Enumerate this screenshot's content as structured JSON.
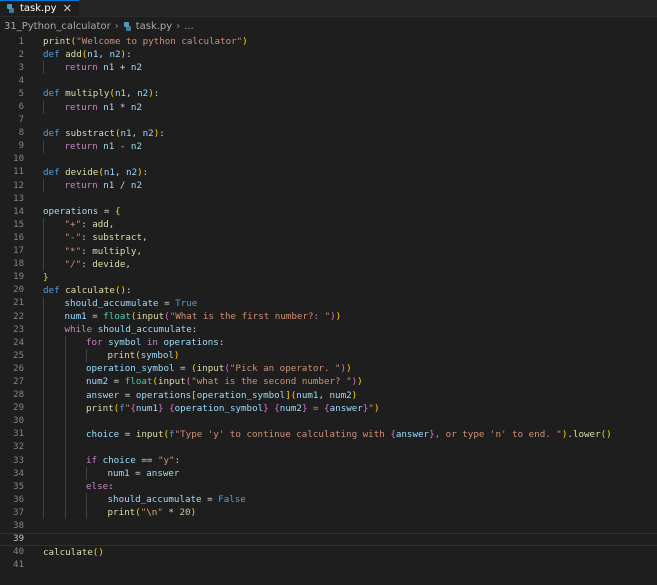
{
  "tab": {
    "title": "task.py",
    "close_glyph": "✕",
    "icon": "python-file-icon"
  },
  "breadcrumb": {
    "folder": "31_Python_calculator",
    "file": "task.py",
    "sep": "›",
    "trail": "..."
  },
  "editor": {
    "current_line": 39,
    "lines": [
      {
        "n": 1,
        "ind": 0,
        "tokens": [
          [
            "fn",
            "print"
          ],
          [
            "br1",
            "("
          ],
          [
            "str",
            "\"Welcome to python calculator\""
          ],
          [
            "br1",
            ")"
          ]
        ]
      },
      {
        "n": 2,
        "ind": 0,
        "tokens": [
          [
            "kw",
            "def "
          ],
          [
            "fn",
            "add"
          ],
          [
            "br1",
            "("
          ],
          [
            "var",
            "n1"
          ],
          [
            "op",
            ", "
          ],
          [
            "var",
            "n2"
          ],
          [
            "br1",
            ")"
          ],
          [
            "op",
            ":"
          ]
        ]
      },
      {
        "n": 3,
        "ind": 1,
        "tokens": [
          [
            "ctl",
            "return "
          ],
          [
            "var",
            "n1"
          ],
          [
            "op",
            " + "
          ],
          [
            "var",
            "n2"
          ]
        ]
      },
      {
        "n": 4,
        "ind": 0,
        "tokens": []
      },
      {
        "n": 5,
        "ind": 0,
        "tokens": [
          [
            "kw",
            "def "
          ],
          [
            "fn",
            "multiply"
          ],
          [
            "br1",
            "("
          ],
          [
            "var",
            "n1"
          ],
          [
            "op",
            ", "
          ],
          [
            "var",
            "n2"
          ],
          [
            "br1",
            ")"
          ],
          [
            "op",
            ":"
          ]
        ]
      },
      {
        "n": 6,
        "ind": 1,
        "tokens": [
          [
            "ctl",
            "return "
          ],
          [
            "var",
            "n1"
          ],
          [
            "op",
            " * "
          ],
          [
            "var",
            "n2"
          ]
        ]
      },
      {
        "n": 7,
        "ind": 0,
        "tokens": []
      },
      {
        "n": 8,
        "ind": 0,
        "tokens": [
          [
            "kw",
            "def "
          ],
          [
            "fn",
            "substract"
          ],
          [
            "br1",
            "("
          ],
          [
            "var",
            "n1"
          ],
          [
            "op",
            ", "
          ],
          [
            "var",
            "n2"
          ],
          [
            "br1",
            ")"
          ],
          [
            "op",
            ":"
          ]
        ]
      },
      {
        "n": 9,
        "ind": 1,
        "tokens": [
          [
            "ctl",
            "return "
          ],
          [
            "var",
            "n1"
          ],
          [
            "op",
            " - "
          ],
          [
            "var",
            "n2"
          ]
        ]
      },
      {
        "n": 10,
        "ind": 0,
        "tokens": []
      },
      {
        "n": 11,
        "ind": 0,
        "tokens": [
          [
            "kw",
            "def "
          ],
          [
            "fn",
            "devide"
          ],
          [
            "br1",
            "("
          ],
          [
            "var",
            "n1"
          ],
          [
            "op",
            ", "
          ],
          [
            "var",
            "n2"
          ],
          [
            "br1",
            ")"
          ],
          [
            "op",
            ":"
          ]
        ]
      },
      {
        "n": 12,
        "ind": 1,
        "tokens": [
          [
            "ctl",
            "return "
          ],
          [
            "var",
            "n1"
          ],
          [
            "op",
            " / "
          ],
          [
            "var",
            "n2"
          ]
        ]
      },
      {
        "n": 13,
        "ind": 0,
        "tokens": []
      },
      {
        "n": 14,
        "ind": 0,
        "tokens": [
          [
            "var",
            "operations"
          ],
          [
            "op",
            " = "
          ],
          [
            "br1",
            "{"
          ]
        ]
      },
      {
        "n": 15,
        "ind": 1,
        "tokens": [
          [
            "str",
            "\"+\""
          ],
          [
            "op",
            ": "
          ],
          [
            "fn",
            "add"
          ],
          [
            "op",
            ","
          ]
        ]
      },
      {
        "n": 16,
        "ind": 1,
        "tokens": [
          [
            "str",
            "\"-\""
          ],
          [
            "op",
            ": "
          ],
          [
            "fn",
            "substract"
          ],
          [
            "op",
            ","
          ]
        ]
      },
      {
        "n": 17,
        "ind": 1,
        "tokens": [
          [
            "str",
            "\"*\""
          ],
          [
            "op",
            ": "
          ],
          [
            "fn",
            "multiply"
          ],
          [
            "op",
            ","
          ]
        ]
      },
      {
        "n": 18,
        "ind": 1,
        "tokens": [
          [
            "str",
            "\"/\""
          ],
          [
            "op",
            ": "
          ],
          [
            "fn",
            "devide"
          ],
          [
            "op",
            ","
          ]
        ]
      },
      {
        "n": 19,
        "ind": 0,
        "tokens": [
          [
            "br1",
            "}"
          ]
        ]
      },
      {
        "n": 20,
        "ind": 0,
        "tokens": [
          [
            "kw",
            "def "
          ],
          [
            "fn",
            "calculate"
          ],
          [
            "br1",
            "()"
          ],
          [
            "op",
            ":"
          ]
        ]
      },
      {
        "n": 21,
        "ind": 1,
        "tokens": [
          [
            "var",
            "should_accumulate"
          ],
          [
            "op",
            " = "
          ],
          [
            "kw",
            "True"
          ]
        ]
      },
      {
        "n": 22,
        "ind": 1,
        "tokens": [
          [
            "var",
            "num1"
          ],
          [
            "op",
            " = "
          ],
          [
            "cls",
            "float"
          ],
          [
            "br1",
            "("
          ],
          [
            "fn",
            "input"
          ],
          [
            "br2",
            "("
          ],
          [
            "str",
            "\"What is the first number?: \""
          ],
          [
            "br2",
            ")"
          ],
          [
            "br1",
            ")"
          ]
        ]
      },
      {
        "n": 23,
        "ind": 1,
        "tokens": [
          [
            "ctl",
            "while "
          ],
          [
            "var",
            "should_accumulate"
          ],
          [
            "op",
            ":"
          ]
        ]
      },
      {
        "n": 24,
        "ind": 2,
        "tokens": [
          [
            "ctl",
            "for "
          ],
          [
            "var",
            "symbol"
          ],
          [
            "ctl",
            " in "
          ],
          [
            "var",
            "operations"
          ],
          [
            "op",
            ":"
          ]
        ]
      },
      {
        "n": 25,
        "ind": 3,
        "tokens": [
          [
            "fn",
            "print"
          ],
          [
            "br1",
            "("
          ],
          [
            "var",
            "symbol"
          ],
          [
            "br1",
            ")"
          ]
        ]
      },
      {
        "n": 26,
        "ind": 2,
        "tokens": [
          [
            "var",
            "operation_symbol"
          ],
          [
            "op",
            " = "
          ],
          [
            "br1",
            "("
          ],
          [
            "fn",
            "input"
          ],
          [
            "br2",
            "("
          ],
          [
            "str",
            "\"Pick an operator. \""
          ],
          [
            "br2",
            ")"
          ],
          [
            "br1",
            ")"
          ]
        ]
      },
      {
        "n": 27,
        "ind": 2,
        "tokens": [
          [
            "var",
            "num2"
          ],
          [
            "op",
            " = "
          ],
          [
            "cls",
            "float"
          ],
          [
            "br1",
            "("
          ],
          [
            "fn",
            "input"
          ],
          [
            "br2",
            "("
          ],
          [
            "str",
            "\"what is the second number? \""
          ],
          [
            "br2",
            ")"
          ],
          [
            "br1",
            ")"
          ]
        ]
      },
      {
        "n": 28,
        "ind": 2,
        "tokens": [
          [
            "var",
            "answer"
          ],
          [
            "op",
            " = "
          ],
          [
            "var",
            "operations"
          ],
          [
            "br1",
            "["
          ],
          [
            "var",
            "operation_symbol"
          ],
          [
            "br1",
            "]"
          ],
          [
            "br1",
            "("
          ],
          [
            "var",
            "num1"
          ],
          [
            "op",
            ", "
          ],
          [
            "var",
            "num2"
          ],
          [
            "br1",
            ")"
          ]
        ]
      },
      {
        "n": 29,
        "ind": 2,
        "tokens": [
          [
            "fn",
            "print"
          ],
          [
            "br1",
            "("
          ],
          [
            "kw",
            "f"
          ],
          [
            "str",
            "\""
          ],
          [
            "br2",
            "{"
          ],
          [
            "var",
            "num1"
          ],
          [
            "br2",
            "}"
          ],
          [
            "str",
            " "
          ],
          [
            "br2",
            "{"
          ],
          [
            "var",
            "operation_symbol"
          ],
          [
            "br2",
            "}"
          ],
          [
            "str",
            " "
          ],
          [
            "br2",
            "{"
          ],
          [
            "var",
            "num2"
          ],
          [
            "br2",
            "}"
          ],
          [
            "str",
            " = "
          ],
          [
            "br2",
            "{"
          ],
          [
            "var",
            "answer"
          ],
          [
            "br2",
            "}"
          ],
          [
            "str",
            "\""
          ],
          [
            "br1",
            ")"
          ]
        ]
      },
      {
        "n": 30,
        "ind": 2,
        "tokens": []
      },
      {
        "n": 31,
        "ind": 2,
        "tokens": [
          [
            "var",
            "choice"
          ],
          [
            "op",
            " = "
          ],
          [
            "fn",
            "input"
          ],
          [
            "br1",
            "("
          ],
          [
            "kw",
            "f"
          ],
          [
            "str",
            "\"Type 'y' to continue calculating with "
          ],
          [
            "br2",
            "{"
          ],
          [
            "var",
            "answer"
          ],
          [
            "br2",
            "}"
          ],
          [
            "str",
            ", or type 'n' to end. \""
          ],
          [
            "br1",
            ")"
          ],
          [
            "op",
            "."
          ],
          [
            "fn",
            "lower"
          ],
          [
            "br1",
            "()"
          ]
        ]
      },
      {
        "n": 32,
        "ind": 2,
        "tokens": []
      },
      {
        "n": 33,
        "ind": 2,
        "tokens": [
          [
            "ctl",
            "if "
          ],
          [
            "var",
            "choice"
          ],
          [
            "op",
            " == "
          ],
          [
            "str",
            "\"y\""
          ],
          [
            "op",
            ":"
          ]
        ]
      },
      {
        "n": 34,
        "ind": 3,
        "tokens": [
          [
            "var",
            "num1"
          ],
          [
            "op",
            " = "
          ],
          [
            "var",
            "answer"
          ]
        ]
      },
      {
        "n": 35,
        "ind": 2,
        "tokens": [
          [
            "ctl",
            "else"
          ],
          [
            "op",
            ":"
          ]
        ]
      },
      {
        "n": 36,
        "ind": 3,
        "tokens": [
          [
            "var",
            "should_accumulate"
          ],
          [
            "op",
            " = "
          ],
          [
            "kw",
            "False"
          ]
        ]
      },
      {
        "n": 37,
        "ind": 3,
        "tokens": [
          [
            "fn",
            "print"
          ],
          [
            "br1",
            "("
          ],
          [
            "str",
            "\""
          ],
          [
            "esc",
            "\\n"
          ],
          [
            "str",
            "\""
          ],
          [
            "op",
            " * "
          ],
          [
            "num",
            "20"
          ],
          [
            "br1",
            ")"
          ]
        ]
      },
      {
        "n": 38,
        "ind": 0,
        "tokens": []
      },
      {
        "n": 39,
        "ind": 0,
        "tokens": []
      },
      {
        "n": 40,
        "ind": 0,
        "tokens": [
          [
            "fn",
            "calculate"
          ],
          [
            "br1",
            "()"
          ]
        ]
      },
      {
        "n": 41,
        "ind": 0,
        "tokens": []
      }
    ]
  }
}
